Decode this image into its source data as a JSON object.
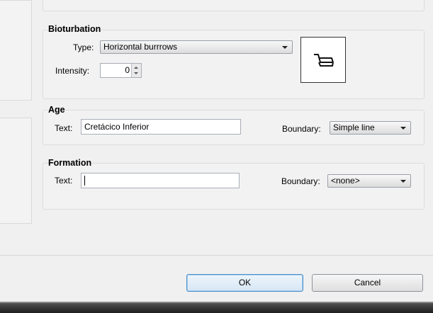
{
  "bioturbation": {
    "title": "Bioturbation",
    "type_label": "Type:",
    "type_value": "Horizontal burrrows",
    "intensity_label": "Intensity:",
    "intensity_value": "0",
    "symbol_icon": "horizontal-burrow-symbol-icon"
  },
  "age": {
    "title": "Age",
    "text_label": "Text:",
    "text_value": "Cretácico Inferior",
    "boundary_label": "Boundary:",
    "boundary_value": "Simple line"
  },
  "formation": {
    "title": "Formation",
    "text_label": "Text:",
    "text_value": "",
    "boundary_label": "Boundary:",
    "boundary_value": "<none>"
  },
  "buttons": {
    "ok": "OK",
    "cancel": "Cancel"
  }
}
